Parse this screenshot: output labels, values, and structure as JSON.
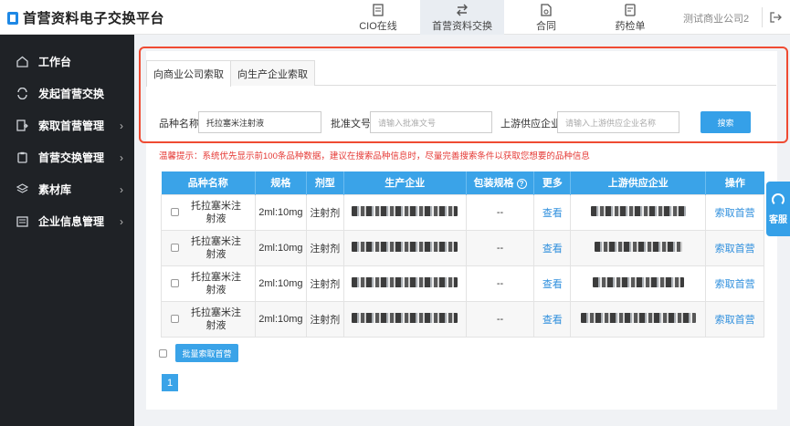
{
  "app": {
    "title": "首营资料电子交换平台"
  },
  "nav": [
    {
      "label": "CIO在线",
      "icon": "document-icon"
    },
    {
      "label": "首营资料交换",
      "icon": "exchange-arrows-icon"
    },
    {
      "label": "合同",
      "icon": "contract-icon"
    },
    {
      "label": "药检单",
      "icon": "report-icon"
    }
  ],
  "header": {
    "company": "测试商业公司2"
  },
  "sidebar": {
    "items": [
      {
        "label": "工作台",
        "icon": "home-icon",
        "has_arrow": false
      },
      {
        "label": "发起首营交换",
        "icon": "sync-icon",
        "has_arrow": false
      },
      {
        "label": "索取首营管理",
        "icon": "request-icon",
        "has_arrow": true
      },
      {
        "label": "首营交换管理",
        "icon": "clipboard-icon",
        "has_arrow": true
      },
      {
        "label": "素材库",
        "icon": "layers-icon",
        "has_arrow": true
      },
      {
        "label": "企业信息管理",
        "icon": "building-icon",
        "has_arrow": true
      }
    ]
  },
  "tabs": [
    "向商业公司索取",
    "向生产企业索取"
  ],
  "search": {
    "product_label": "品种名称",
    "product_value": "托拉塞米注射液",
    "approval_label": "批准文号",
    "approval_placeholder": "请输入批准文号",
    "supplier_label": "上游供应企业",
    "supplier_placeholder": "请输入上游供应企业名称",
    "button": "搜索"
  },
  "tip": "温馨提示：系统优先显示前100条品种数据，建议在搜索品种信息时，尽量完善搜索条件以获取您想要的品种信息",
  "table": {
    "headers": [
      "品种名称",
      "规格",
      "剂型",
      "生产企业",
      "包装规格",
      "更多",
      "上游供应企业",
      "操作"
    ],
    "rows": [
      {
        "name": "托拉塞米注射液",
        "spec": "2ml:10mg",
        "form": "注射剂",
        "package": "--",
        "more": "查看",
        "action": "索取首营"
      },
      {
        "name": "托拉塞米注射液",
        "spec": "2ml:10mg",
        "form": "注射剂",
        "package": "--",
        "more": "查看",
        "action": "索取首营"
      },
      {
        "name": "托拉塞米注射液",
        "spec": "2ml:10mg",
        "form": "注射剂",
        "package": "--",
        "more": "查看",
        "action": "索取首营"
      },
      {
        "name": "托拉塞米注射液",
        "spec": "2ml:10mg",
        "form": "注射剂",
        "package": "--",
        "more": "查看",
        "action": "索取首营"
      }
    ]
  },
  "batch_button": "批量索取首营",
  "pagination": {
    "current": "1"
  },
  "service": {
    "label": "客服",
    "icon": "headset-icon"
  },
  "colors": {
    "primary": "#3aa3e8",
    "highlight": "#ef4b32",
    "sidebar": "#1f2226",
    "tip": "#e53935"
  }
}
